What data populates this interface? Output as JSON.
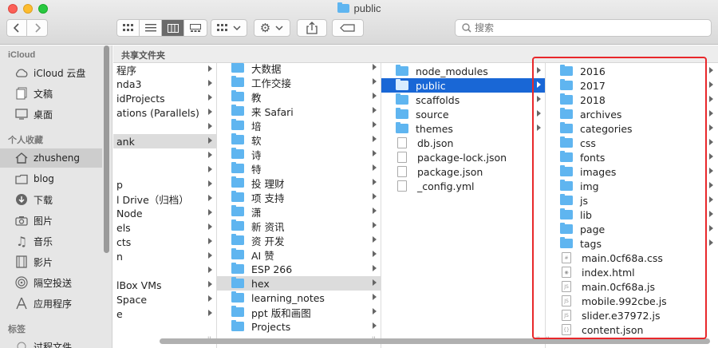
{
  "window": {
    "title": "public"
  },
  "toolbar": {
    "search_placeholder": "搜索"
  },
  "sidebar": {
    "sections": [
      {
        "heading": "iCloud",
        "items": [
          {
            "label": "iCloud 云盘",
            "icon": "cloud-icon"
          },
          {
            "label": "文稿",
            "icon": "documents-icon"
          },
          {
            "label": "桌面",
            "icon": "desktop-icon"
          }
        ]
      },
      {
        "heading": "个人收藏",
        "items": [
          {
            "label": "zhusheng",
            "icon": "home-icon",
            "selected": true
          },
          {
            "label": "blog",
            "icon": "folder-icon"
          },
          {
            "label": "下载",
            "icon": "download-icon"
          },
          {
            "label": "图片",
            "icon": "camera-icon"
          },
          {
            "label": "音乐",
            "icon": "music-icon"
          },
          {
            "label": "影片",
            "icon": "film-icon"
          },
          {
            "label": "隔空投送",
            "icon": "airdrop-icon"
          },
          {
            "label": "应用程序",
            "icon": "applications-icon"
          }
        ]
      },
      {
        "heading": "标签",
        "items": [
          {
            "label": "过程文件",
            "icon": "tag-icon"
          }
        ]
      }
    ]
  },
  "pathbar": {
    "label": "共享文件夹"
  },
  "columns": {
    "col1": [
      {
        "name": "程序",
        "chev": true
      },
      {
        "name": "nda3",
        "chev": true
      },
      {
        "name": "idProjects",
        "chev": true
      },
      {
        "name": "ations (Parallels)",
        "chev": true
      },
      {
        "name": "",
        "chev": true
      },
      {
        "name": "ank",
        "chev": true,
        "hl": true
      },
      {
        "name": "",
        "chev": true
      },
      {
        "name": "",
        "chev": true
      },
      {
        "name": "p",
        "chev": true
      },
      {
        "name": "l Drive（归档）",
        "chev": true
      },
      {
        "name": "Node",
        "chev": true
      },
      {
        "name": "els",
        "chev": true
      },
      {
        "name": "cts",
        "chev": true
      },
      {
        "name": "n",
        "chev": true
      },
      {
        "name": "",
        "chev": true
      },
      {
        "name": "lBox VMs",
        "chev": true
      },
      {
        "name": "Space",
        "chev": true
      },
      {
        "name": "e",
        "chev": true
      }
    ],
    "col2": [
      {
        "name": "大数据",
        "chev": true
      },
      {
        "name": "工作交接",
        "chev": true
      },
      {
        "name": "教",
        "chev": true
      },
      {
        "name": "来 Safari",
        "chev": true
      },
      {
        "name": "培",
        "chev": true
      },
      {
        "name": "软",
        "chev": true
      },
      {
        "name": "诗",
        "chev": true
      },
      {
        "name": "特",
        "chev": true
      },
      {
        "name": "投 理财",
        "chev": true
      },
      {
        "name": "项 支持",
        "chev": true
      },
      {
        "name": "潇",
        "chev": true
      },
      {
        "name": "新 资讯",
        "chev": true
      },
      {
        "name": "资 开发",
        "chev": true
      },
      {
        "name": "AI 赞",
        "chev": true
      },
      {
        "name": "ESP 266",
        "chev": true
      },
      {
        "name": "hex",
        "chev": true,
        "hl": true
      },
      {
        "name": "learning_notes",
        "chev": true
      },
      {
        "name": "ppt 版和画图",
        "chev": true
      },
      {
        "name": "Projects",
        "chev": true
      }
    ],
    "col3": [
      {
        "name": "node_modules",
        "kind": "folder",
        "chev": true
      },
      {
        "name": "public",
        "kind": "folder",
        "chev": true,
        "sel": true
      },
      {
        "name": "scaffolds",
        "kind": "folder",
        "chev": true
      },
      {
        "name": "source",
        "kind": "folder",
        "chev": true
      },
      {
        "name": "themes",
        "kind": "folder",
        "chev": true
      },
      {
        "name": "db.json",
        "kind": "file"
      },
      {
        "name": "package-lock.json",
        "kind": "file"
      },
      {
        "name": "package.json",
        "kind": "file"
      },
      {
        "name": "_config.yml",
        "kind": "file"
      }
    ],
    "col4": [
      {
        "name": "2016",
        "kind": "folder",
        "chev": true
      },
      {
        "name": "2017",
        "kind": "folder",
        "chev": true
      },
      {
        "name": "2018",
        "kind": "folder",
        "chev": true
      },
      {
        "name": "archives",
        "kind": "folder",
        "chev": true
      },
      {
        "name": "categories",
        "kind": "folder",
        "chev": true
      },
      {
        "name": "css",
        "kind": "folder",
        "chev": true
      },
      {
        "name": "fonts",
        "kind": "folder",
        "chev": true
      },
      {
        "name": "images",
        "kind": "folder",
        "chev": true
      },
      {
        "name": "img",
        "kind": "folder",
        "chev": true
      },
      {
        "name": "js",
        "kind": "folder",
        "chev": true
      },
      {
        "name": "lib",
        "kind": "folder",
        "chev": true
      },
      {
        "name": "page",
        "kind": "folder",
        "chev": true
      },
      {
        "name": "tags",
        "kind": "folder",
        "chev": true
      },
      {
        "name": "main.0cf68a.css",
        "kind": "file",
        "glyph": "#"
      },
      {
        "name": "index.html",
        "kind": "file",
        "glyph": "◉"
      },
      {
        "name": "main.0cf68a.js",
        "kind": "file",
        "glyph": "JS"
      },
      {
        "name": "mobile.992cbe.js",
        "kind": "file",
        "glyph": "JS"
      },
      {
        "name": "slider.e37972.js",
        "kind": "file",
        "glyph": "JS"
      },
      {
        "name": "content.json",
        "kind": "file",
        "glyph": "{}"
      }
    ]
  },
  "colors": {
    "selection": "#1967d6",
    "folder": "#5fb5f0",
    "highlight": "#e8282b"
  }
}
